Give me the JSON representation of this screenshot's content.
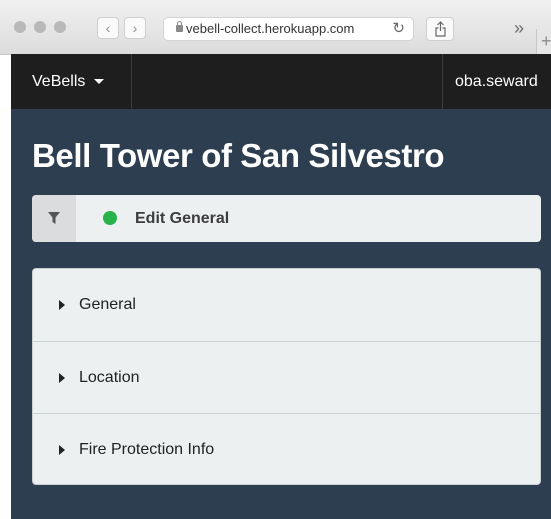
{
  "browser": {
    "url": "vebell-collect.herokuapp.com",
    "back_icon": "chevron-left-icon",
    "forward_icon": "chevron-right-icon",
    "reload_icon": "reload-icon",
    "share_icon": "share-icon",
    "overflow_label": "»",
    "new_tab_label": "+"
  },
  "navbar": {
    "brand": "VeBells",
    "user": "oba.seward"
  },
  "page": {
    "title": "Bell Tower of San Silvestro"
  },
  "filter_bar": {
    "label": "Edit General",
    "status_color": "#27b34a"
  },
  "sections": [
    {
      "label": "General"
    },
    {
      "label": "Location"
    },
    {
      "label": "Fire Protection Info"
    }
  ],
  "colors": {
    "app_background": "#2c3e50",
    "navbar_background": "#1e1e1e",
    "panel_background": "#ecf0f1"
  }
}
